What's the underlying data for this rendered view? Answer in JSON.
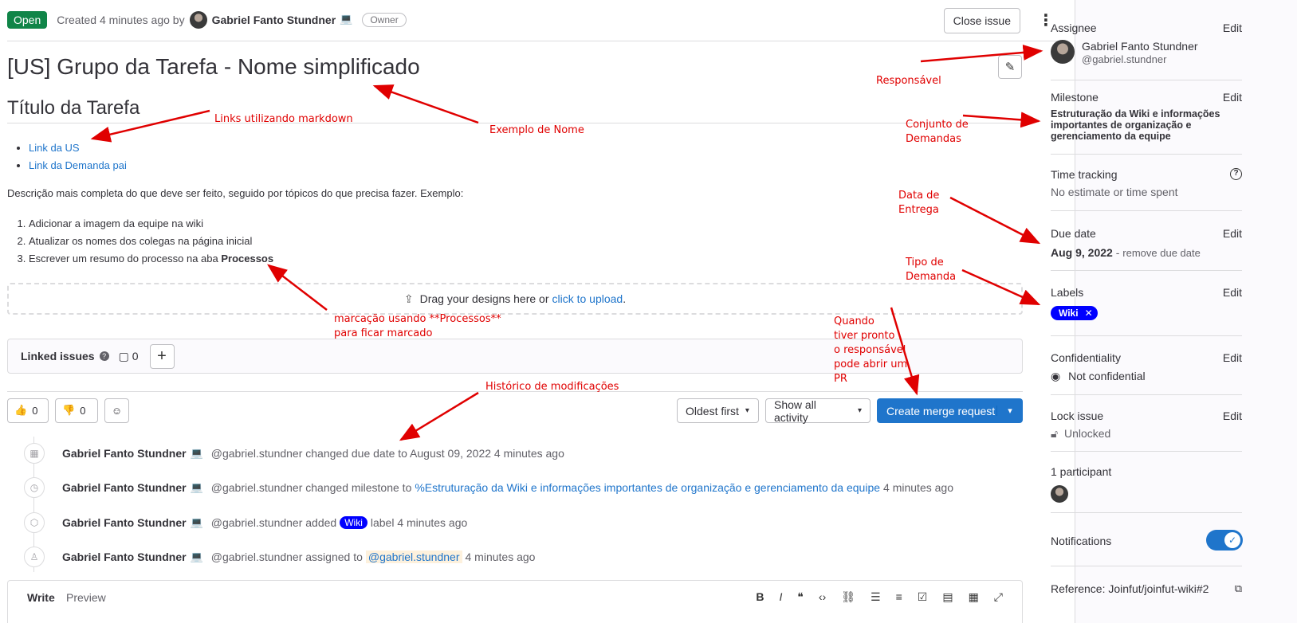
{
  "header": {
    "status": "Open",
    "created_prefix": "Created 4 minutes ago by",
    "author": "Gabriel Fanto Stundner",
    "author_emoji": "💻",
    "role_badge": "Owner",
    "close_label": "Close issue",
    "more_icon": "kebab-vertical-icon"
  },
  "issue": {
    "title": "[US] Grupo da Tarefa - Nome simplificado",
    "section_heading": "Título da Tarefa",
    "links": [
      "Link da US",
      "Link da Demanda pai"
    ],
    "description": "Descrição mais completa do que deve ser feito, seguido por tópicos do que precisa fazer. Exemplo:",
    "steps": [
      "Adicionar a imagem da equipe na wiki",
      "Atualizar os nomes dos colegas na página inicial",
      "Escrever um resumo do processo na aba "
    ],
    "steps_bold": "Processos"
  },
  "dropzone": {
    "text": "Drag your designs here or ",
    "link": "click to upload",
    "suffix": "."
  },
  "linked_issues": {
    "title": "Linked issues",
    "count": "0"
  },
  "reactions": {
    "thumbs_up": "0",
    "thumbs_down": "0"
  },
  "controls": {
    "sort": "Oldest first",
    "filter": "Show all activity",
    "create_mr": "Create merge request"
  },
  "timeline": [
    {
      "icon": "calendar-icon",
      "name": "Gabriel Fanto Stundner",
      "text": "@gabriel.stundner changed due date to August 09, 2022 4 minutes ago"
    },
    {
      "icon": "clock-icon",
      "name": "Gabriel Fanto Stundner",
      "text": "@gabriel.stundner changed milestone to",
      "link": "%Estruturação da Wiki e informações importantes de organização e gerenciamento da equipe",
      "suffix": "4 minutes ago"
    },
    {
      "icon": "label-icon",
      "name": "Gabriel Fanto Stundner",
      "text": "@gabriel.stundner added",
      "chip": "Wiki",
      "suffix": "label 4 minutes ago"
    },
    {
      "icon": "user-icon",
      "name": "Gabriel Fanto Stundner",
      "text": "@gabriel.stundner assigned to",
      "mention": "@gabriel.stundner",
      "suffix": "4 minutes ago"
    }
  ],
  "composer": {
    "tab_write": "Write",
    "tab_preview": "Preview"
  },
  "sidebar": {
    "edit": "Edit",
    "assignee": {
      "title": "Assignee",
      "name": "Gabriel Fanto Stundner",
      "handle": "@gabriel.stundner"
    },
    "milestone": {
      "title": "Milestone",
      "value": "Estruturação da Wiki e informações importantes de organização e gerenciamento da equipe"
    },
    "time_tracking": {
      "title": "Time tracking",
      "value": "No estimate or time spent"
    },
    "due_date": {
      "title": "Due date",
      "value": "Aug 9, 2022",
      "remove": "remove due date"
    },
    "labels": {
      "title": "Labels",
      "chip": "Wiki"
    },
    "confidentiality": {
      "title": "Confidentiality",
      "value": "Not confidential"
    },
    "lock": {
      "title": "Lock issue",
      "value": "Unlocked"
    },
    "participants": {
      "title": "1 participant"
    },
    "notifications": {
      "title": "Notifications",
      "enabled": true
    },
    "reference": "Reference: Joinfut/joinfut-wiki#2"
  },
  "annotations": {
    "responsavel": "Responsável",
    "links_markdown": "Links utilizando markdown",
    "exemplo_nome": "Exemplo de Nome",
    "conjunto_1": "Conjunto de",
    "conjunto_2": "Demandas",
    "data_1": "Data de",
    "data_2": "Entrega",
    "tipo_1": "Tipo de",
    "tipo_2": "Demanda",
    "marcacao_1": "marcação usando **Processos**",
    "marcacao_2": "para ficar marcado",
    "quando_1": "Quando",
    "quando_2": "tiver pronto",
    "quando_3": "o responsável",
    "quando_4": "pode abrir um",
    "quando_5": "PR",
    "historico": "Histórico de modificações"
  },
  "colors": {
    "open": "#108548",
    "primary": "#1f75cb",
    "label_wiki": "#0000ff",
    "annotation": "#e00000"
  }
}
